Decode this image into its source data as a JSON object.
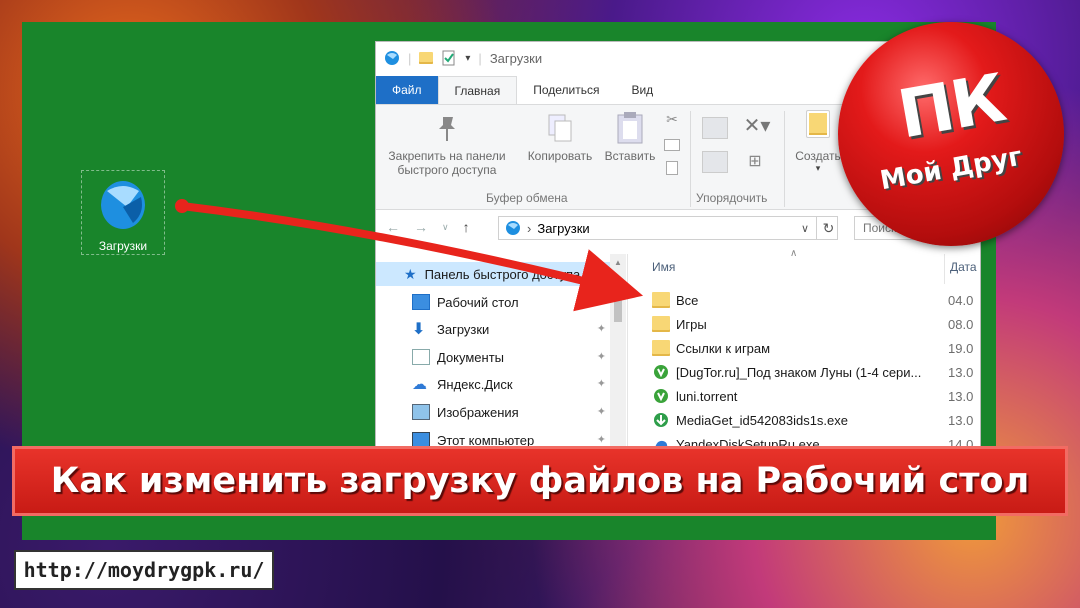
{
  "desktop": {
    "icon_label": "Загрузки"
  },
  "explorer": {
    "title": "Загрузки",
    "tabs": [
      "Файл",
      "Главная",
      "Поделиться",
      "Вид"
    ],
    "ribbon": {
      "pin_label_1": "Закрепить на панели",
      "pin_label_2": "быстрого доступа",
      "copy_label": "Копировать",
      "paste_label": "Вставить",
      "clipboard_group": "Буфер обмена",
      "organize_group": "Упорядочить",
      "create_label": "Создать"
    },
    "address": {
      "path": "Загрузки",
      "search_placeholder": "Поиск"
    },
    "nav_items": [
      {
        "label": "Панель быстрого доступа",
        "icon": "star-icon"
      },
      {
        "label": "Рабочий стол",
        "icon": "desktop-icon"
      },
      {
        "label": "Загрузки",
        "icon": "download-icon"
      },
      {
        "label": "Документы",
        "icon": "documents-icon"
      },
      {
        "label": "Яндекс.Диск",
        "icon": "yandex-disk-icon"
      },
      {
        "label": "Изображения",
        "icon": "images-icon"
      },
      {
        "label": "Этот компьютер",
        "icon": "computer-icon"
      }
    ],
    "columns": {
      "name": "Имя",
      "date": "Дата"
    },
    "files": [
      {
        "name": "Все",
        "date": "04.0",
        "icon": "folder-icon"
      },
      {
        "name": "Игры",
        "date": "08.0",
        "icon": "folder-icon"
      },
      {
        "name": "Ссылки к играм",
        "date": "19.0",
        "icon": "folder-icon"
      },
      {
        "name": "[DugTor.ru]_Под знаком Луны (1-4 сери...",
        "date": "13.0",
        "icon": "torrent-icon"
      },
      {
        "name": "luni.torrent",
        "date": "13.0",
        "icon": "torrent-icon"
      },
      {
        "name": "MediaGet_id542083ids1s.exe",
        "date": "13.0",
        "icon": "mediaget-icon"
      },
      {
        "name": "YandexDiskSetupRu.exe",
        "date": "14.0",
        "icon": "yandex-setup-icon"
      }
    ]
  },
  "logo": {
    "main": "ПК",
    "sub": "Мой Друг"
  },
  "banner": {
    "text": "Как изменить загрузку файлов на Рабочий стол"
  },
  "url": {
    "text": "http://moydrygpk.ru/"
  },
  "colors": {
    "green": "#19852b",
    "banner_red": "#d8231c",
    "file_tab_blue": "#1e6fc7",
    "arrow_red": "#e8241c"
  }
}
